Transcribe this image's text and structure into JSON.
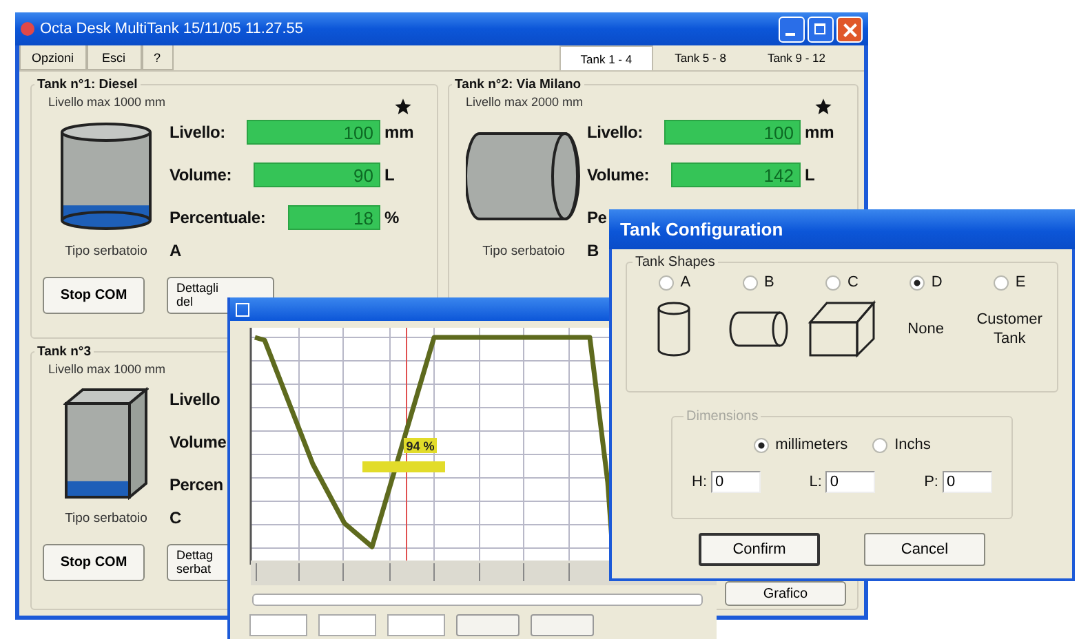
{
  "main_window": {
    "title": "Octa Desk MultiTank 15/11/05 11.27.55",
    "menu": [
      "Opzioni",
      "Esci",
      "?"
    ],
    "tabs": [
      {
        "label": "Tank 1 - 4",
        "selected": true
      },
      {
        "label": "Tank 5 - 8",
        "selected": false
      },
      {
        "label": "Tank 9 - 12",
        "selected": false
      }
    ]
  },
  "tanks": [
    {
      "title": "Tank n°1: Diesel",
      "max_level": "Livello max 1000 mm",
      "starred": true,
      "kind": "cylinder",
      "level": 0.17,
      "readings": [
        {
          "label": "Livello:",
          "value": "100",
          "unit": "mm"
        },
        {
          "label": "Volume:",
          "value": "90",
          "unit": "L"
        },
        {
          "label": "Percentuale:",
          "value": "18",
          "unit": "%"
        }
      ],
      "type_label": "Tipo serbatoio",
      "type": "A",
      "buttons": [
        "Stop COM",
        "Dettagli del"
      ]
    },
    {
      "title": "Tank n°2: Via Milano",
      "max_level": "Livello max 2000 mm",
      "starred": true,
      "kind": "horizontal",
      "readings": [
        {
          "label": "Livello:",
          "value": "100",
          "unit": "mm"
        },
        {
          "label": "Volume:",
          "value": "142",
          "unit": "L"
        },
        {
          "label": "Pe"
        }
      ],
      "type_label": "Tipo serbatoio",
      "type": "B"
    },
    {
      "title": "Tank n°3",
      "max_level": "Livello max 1000 mm",
      "kind": "box",
      "level": 0.17,
      "readings": [
        {
          "label": "Livello"
        },
        {
          "label": "Volume"
        },
        {
          "label": "Percen"
        }
      ],
      "type_label": "Tipo serbatoio",
      "type": "C",
      "buttons": [
        "Stop COM",
        "Dettag serbat"
      ]
    }
  ],
  "covered_panel": {
    "button": "Grafico"
  },
  "graph_window": {
    "tag": "94 %"
  },
  "dialog": {
    "title": "Tank Configuration",
    "shapes_label": "Tank Shapes",
    "shapes": [
      {
        "label": "A",
        "selected": false,
        "kind": "cylinder"
      },
      {
        "label": "B",
        "selected": false,
        "kind": "horizontal"
      },
      {
        "label": "C",
        "selected": false,
        "kind": "box"
      },
      {
        "label": "D",
        "selected": true,
        "kind": "text",
        "caption": "None"
      },
      {
        "label": "E",
        "selected": false,
        "kind": "text",
        "caption": "Customer Tank"
      }
    ],
    "dimensions_label": "Dimensions",
    "units": [
      {
        "label": "millimeters",
        "selected": true
      },
      {
        "label": "Inchs",
        "selected": false
      }
    ],
    "fields": [
      {
        "label": "H:",
        "value": "0"
      },
      {
        "label": "L:",
        "value": "0"
      },
      {
        "label": "P:",
        "value": "0"
      }
    ],
    "buttons": [
      {
        "label": "Confirm",
        "focused": true
      },
      {
        "label": "Cancel",
        "focused": false
      }
    ]
  }
}
